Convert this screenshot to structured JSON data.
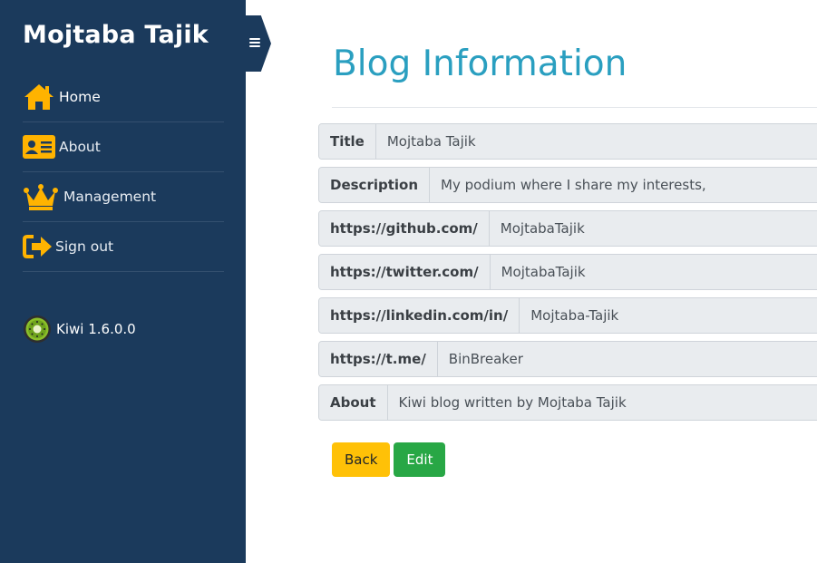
{
  "sidebar": {
    "brand": "Mojtaba Tajik",
    "items": [
      {
        "label": "Home",
        "icon": "home-icon"
      },
      {
        "label": "About",
        "icon": "id-card-icon"
      },
      {
        "label": "Management",
        "icon": "crown-icon"
      },
      {
        "label": "Sign out",
        "icon": "sign-out-icon"
      }
    ],
    "version": "Kiwi 1.6.0.0",
    "accent_color": "#ffb300",
    "background_color": "#1b3a5c"
  },
  "main": {
    "title": "Blog Information",
    "title_color": "#2a9fc0",
    "fields": [
      {
        "key": "Title",
        "value": "Mojtaba Tajik"
      },
      {
        "key": "Description",
        "value": "My podium where I share my interests,"
      },
      {
        "key": "https://github.com/",
        "value": "MojtabaTajik"
      },
      {
        "key": "https://twitter.com/",
        "value": "MojtabaTajik"
      },
      {
        "key": "https://linkedin.com/in/",
        "value": "Mojtaba-Tajik"
      },
      {
        "key": "https://t.me/",
        "value": "BinBreaker"
      },
      {
        "key": "About",
        "value": "Kiwi blog written by Mojtaba Tajik"
      }
    ],
    "buttons": {
      "back": "Back",
      "edit": "Edit"
    }
  }
}
